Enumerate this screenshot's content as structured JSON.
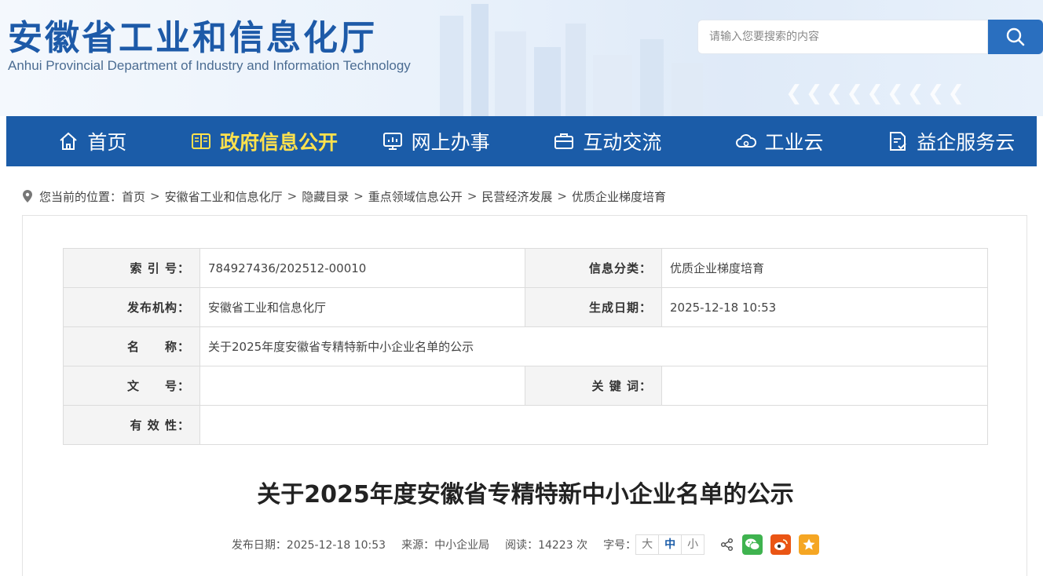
{
  "header": {
    "title": "安徽省工业和信息化厅",
    "subtitle": "Anhui Provincial Department of Industry and Information Technology",
    "search_placeholder": "请输入您要搜索的内容"
  },
  "nav": [
    {
      "label": "首页",
      "icon": "home-icon"
    },
    {
      "label": "政府信息公开",
      "icon": "book-icon",
      "active": true
    },
    {
      "label": "网上办事",
      "icon": "monitor-icon"
    },
    {
      "label": "互动交流",
      "icon": "briefcase-icon"
    },
    {
      "label": "工业云",
      "icon": "cloud-icon"
    },
    {
      "label": "益企服务云",
      "icon": "document-check-icon"
    }
  ],
  "breadcrumb": {
    "prefix": "您当前的位置：",
    "items": [
      "首页",
      "安徽省工业和信息化厅",
      "隐藏目录",
      "重点领域信息公开",
      "民营经济发展",
      "优质企业梯度培育"
    ],
    "separator": ">"
  },
  "meta_table": {
    "index_label": "索 引 号：",
    "index_value": "784927436/202512-00010",
    "category_label": "信息分类：",
    "category_value": "优质企业梯度培育",
    "publisher_label": "发布机构：",
    "publisher_value": "安徽省工业和信息化厅",
    "date_label": "生成日期：",
    "date_value": "2025-12-18 10:53",
    "name_label": "名　　称：",
    "name_value": "关于2025年度安徽省专精特新中小企业名单的公示",
    "docno_label": "文　　号：",
    "docno_value": "",
    "keywords_label": "关 键 词：",
    "keywords_value": "",
    "validity_label": "有 效 性：",
    "validity_value": ""
  },
  "article": {
    "title": "关于2025年度安徽省专精特新中小企业名单的公示",
    "publish_date": "发布日期：2025-12-18 10:53",
    "source": "来源：中小企业局",
    "reads": "阅读：14223 次",
    "font_size_label": "字号：",
    "font_sizes": [
      "大",
      "中",
      "小"
    ]
  },
  "colors": {
    "nav_bg": "#1b5ca8",
    "nav_active": "#ffe14d",
    "title_blue": "#1d5aa8"
  }
}
